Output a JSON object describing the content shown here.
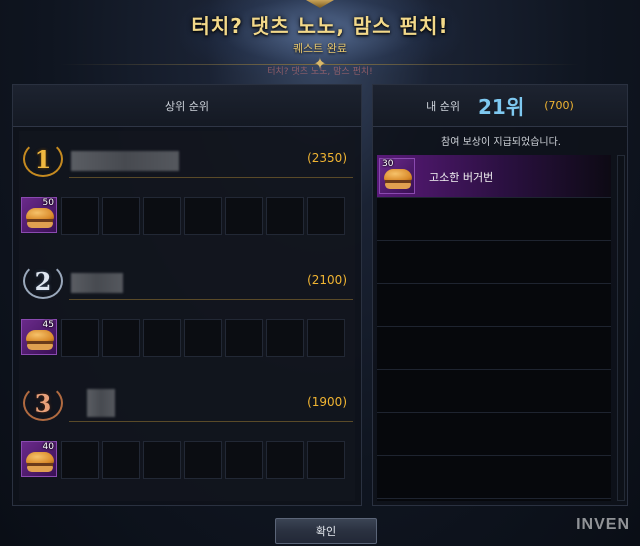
{
  "header": {
    "title": "터치? 댓츠 노노, 맘스 펀치!",
    "subtitle": "퀘스트 완료",
    "faint_text": "터치? 댓츠 노노, 맘스 펀치!"
  },
  "left_panel": {
    "title": "상위 순위",
    "ranks": [
      {
        "rank": "1",
        "score": "(2350)",
        "reward_qty": "50",
        "medal": "gold"
      },
      {
        "rank": "2",
        "score": "(2100)",
        "reward_qty": "45",
        "medal": "silver"
      },
      {
        "rank": "3",
        "score": "(1900)",
        "reward_qty": "40",
        "medal": "bronze"
      }
    ]
  },
  "right_panel": {
    "label": "내 순위",
    "rank": "21위",
    "score": "(700)",
    "notice": "참여 보상이 지급되었습니다.",
    "rewards": [
      {
        "name": "고소한 버거번",
        "qty": "30"
      }
    ]
  },
  "confirm_button": "확인",
  "watermark": "INVEN",
  "icons": {
    "reward_item": "burger-bun-icon",
    "medal": "laurel-medal-icon"
  }
}
